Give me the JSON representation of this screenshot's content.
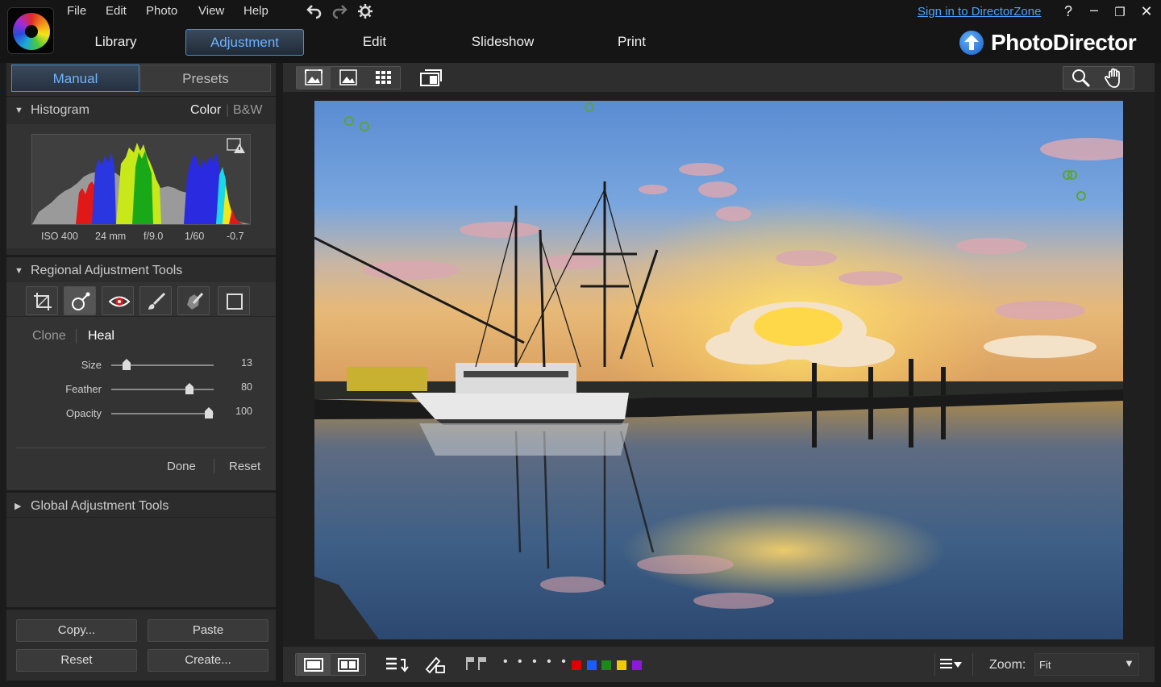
{
  "menu": [
    "File",
    "Edit",
    "Photo",
    "View",
    "Help"
  ],
  "toolbar_icons": [
    "undo-icon",
    "redo-icon",
    "settings-icon"
  ],
  "mode_tabs": [
    {
      "label": "Library",
      "active": false
    },
    {
      "label": "Adjustment",
      "active": true
    },
    {
      "label": "Edit",
      "active": false
    },
    {
      "label": "Slideshow",
      "active": false
    },
    {
      "label": "Print",
      "active": false
    }
  ],
  "signin": "Sign in to DirectorZone",
  "window_controls": {
    "help": "?",
    "minimize": "–",
    "restore": "❐",
    "close": "✕"
  },
  "brand": "PhotoDirector",
  "panel_tabs": {
    "manual": "Manual",
    "presets": "Presets"
  },
  "histogram": {
    "title": "Histogram",
    "mode_color": "Color",
    "mode_bw": "B&W",
    "exif": [
      "ISO 400",
      "24 mm",
      "f/9.0",
      "1/60",
      "-0.7"
    ]
  },
  "regional": {
    "title": "Regional Adjustment Tools",
    "tools": [
      "crop-icon",
      "spot-removal-icon",
      "red-eye-icon",
      "brush-icon",
      "gradient-mask-icon",
      "frame-icon"
    ],
    "modes": {
      "clone": "Clone",
      "heal": "Heal"
    },
    "sliders": [
      {
        "label": "Size",
        "value": "13",
        "fraction": 0.15
      },
      {
        "label": "Feather",
        "value": "80",
        "fraction": 0.78
      },
      {
        "label": "Opacity",
        "value": "100",
        "fraction": 0.95
      }
    ],
    "done": "Done",
    "reset": "Reset"
  },
  "global": {
    "title": "Global Adjustment Tools"
  },
  "bottom_buttons": {
    "copy": "Copy...",
    "paste": "Paste",
    "reset": "Reset",
    "create": "Create..."
  },
  "view_modes": [
    "fit-view-icon",
    "single-view-icon",
    "grid-view-icon",
    "compare-view-icon"
  ],
  "viewer_tools": [
    "zoom-tool-icon",
    "pan-hand-icon"
  ],
  "bottom_bar": {
    "icons": [
      "single-photo-icon",
      "side-by-side-icon",
      "sort-icon",
      "edit-tag-icon",
      "flag-icon"
    ],
    "rating_dots": "• • • • •",
    "color_labels": [
      "#e00000",
      "#1a5cff",
      "#1a8a1a",
      "#f2c800",
      "#8a1ad8"
    ],
    "zoom_label": "Zoom:",
    "zoom_value": "Fit"
  },
  "accent_color": "#4a8fd0"
}
